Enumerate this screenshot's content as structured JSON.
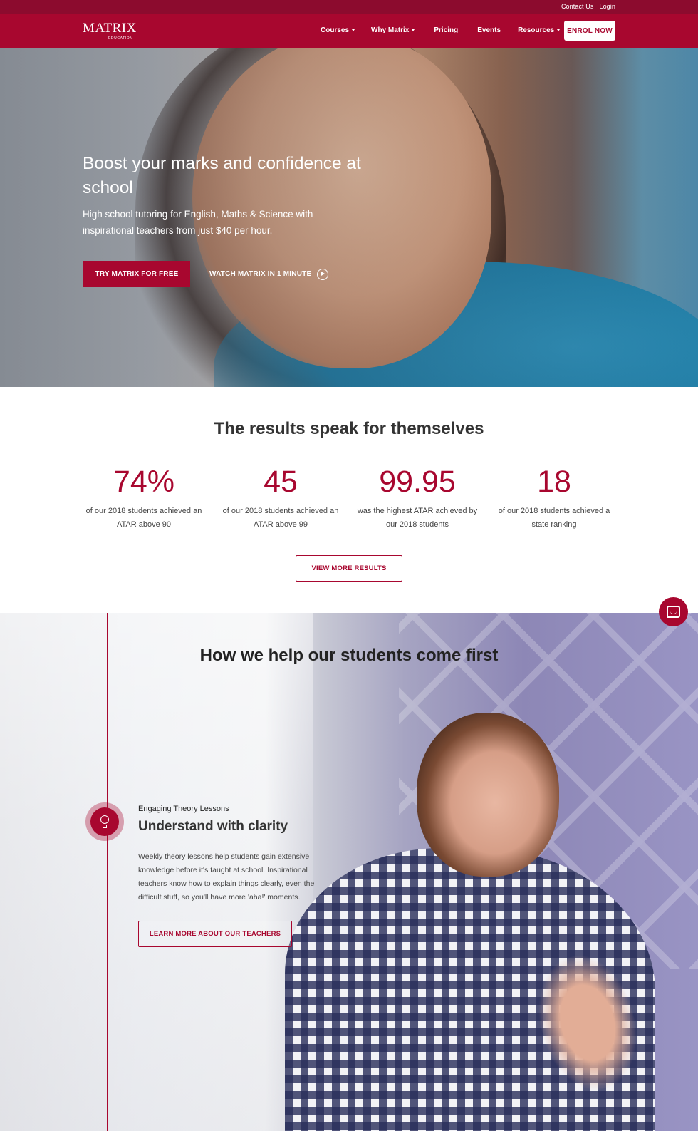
{
  "topbar": {
    "links": [
      "Contact Us",
      "Login"
    ]
  },
  "navbar": {
    "logo": {
      "word": "MATRIX",
      "sub": "EDUCATION"
    },
    "items": [
      {
        "label": "Courses",
        "dropdown": true
      },
      {
        "label": "Why Matrix",
        "dropdown": true
      },
      {
        "label": "Pricing",
        "dropdown": false
      },
      {
        "label": "Events",
        "dropdown": false
      },
      {
        "label": "Resources",
        "dropdown": true
      }
    ],
    "cta": "ENROL NOW"
  },
  "hero": {
    "title": "Boost your marks and confidence at school",
    "subtitle": "High school tutoring for English, Maths & Science with inspirational teachers from just $40 per hour.",
    "primary_button": "TRY MATRIX FOR FREE",
    "video_link": "WATCH MATRIX IN 1 MINUTE",
    "video_icon": "play-circle-icon"
  },
  "results": {
    "title": "The results speak for themselves",
    "stats": [
      {
        "value": "74%",
        "desc": "of our 2018 students achieved an ATAR above 90"
      },
      {
        "value": "45",
        "desc": "of our 2018 students achieved an ATAR above 99"
      },
      {
        "value": "99.95",
        "desc": "was the highest ATAR achieved by our 2018 students"
      },
      {
        "value": "18",
        "desc": "of our 2018 students achieved a state ranking"
      }
    ],
    "button": "VIEW MORE RESULTS"
  },
  "chat": {
    "icon": "chat-bubble-icon"
  },
  "help": {
    "title": "How we help our students come first",
    "feature": {
      "icon": "lightbulb-icon",
      "kicker": "Engaging Theory Lessons",
      "title": "Understand with clarity",
      "text": "Weekly theory lessons help students gain extensive knowledge before it's taught at school. Inspirational teachers know how to explain things clearly, even the difficult stuff, so you'll have more 'aha!' moments.",
      "button": "LEARN MORE ABOUT OUR TEACHERS"
    }
  },
  "colors": {
    "brand": "#a8072f",
    "topbar": "#8c0b2e",
    "white": "#ffffff"
  }
}
